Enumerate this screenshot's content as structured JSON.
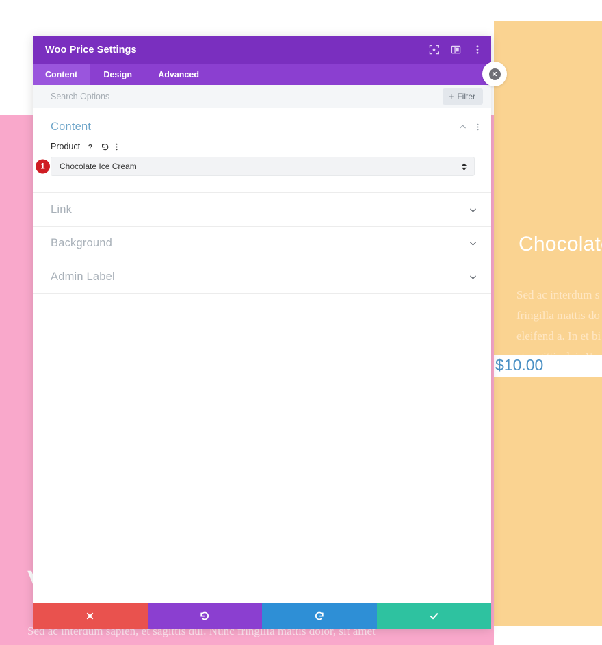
{
  "preview": {
    "product_heading": "Chocolate Ic",
    "product_body": "Sed ac interdum s\nfringilla mattis do\neleifend a. In et bi\net sagittis dui. Nu",
    "price": "$10.00",
    "left_letter": "V",
    "bottom_caption": "Sed ac interdum sapien, et sagittis dui. Nunc fringilla mattis dolor, sit amet",
    "colors": {
      "pink": "#f9a8cb",
      "orange": "#fad391",
      "price_blue": "#4a90c4"
    }
  },
  "modal": {
    "title": "Woo Price Settings",
    "header_icons": [
      {
        "name": "focus-mode-icon",
        "label": "Focus mode"
      },
      {
        "name": "panel-layout-icon",
        "label": "Change layout"
      },
      {
        "name": "more-options-icon",
        "label": "More options"
      }
    ],
    "tabs": [
      {
        "label": "Content",
        "active": true
      },
      {
        "label": "Design",
        "active": false
      },
      {
        "label": "Advanced",
        "active": false
      }
    ],
    "search": {
      "placeholder": "Search Options",
      "value": ""
    },
    "filter_button": {
      "plus": "+",
      "label": "Filter"
    },
    "sections": [
      {
        "title": "Content",
        "state": "expanded",
        "collapse_icon": "chevron-up-icon",
        "more_icon": "more-options-icon"
      },
      {
        "title": "Link",
        "state": "collapsed"
      },
      {
        "title": "Background",
        "state": "collapsed"
      },
      {
        "title": "Admin Label",
        "state": "collapsed"
      }
    ],
    "product_field": {
      "label": "Product",
      "help_icon": "help-icon",
      "reset_icon": "reset-icon",
      "more_icon": "more-options-icon",
      "badge": "1",
      "selected_value": "Chocolate Ice Cream",
      "options": [
        "Chocolate Ice Cream"
      ]
    },
    "footer_buttons": [
      {
        "name": "cancel-button",
        "glyph": "✖",
        "color": "#e9524e"
      },
      {
        "name": "undo-button",
        "glyph": "↺",
        "color": "#8b3fd0"
      },
      {
        "name": "redo-button",
        "glyph": "↻",
        "color": "#2e8fd6"
      },
      {
        "name": "save-button",
        "glyph": "✔",
        "color": "#2ec2a0"
      }
    ],
    "close_button": {
      "name": "close-preview-button",
      "glyph": "✕"
    }
  }
}
